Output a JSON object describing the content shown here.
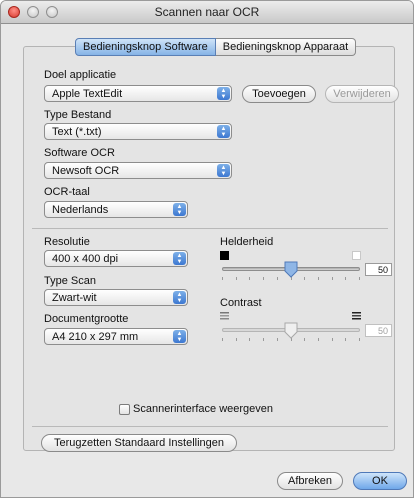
{
  "window": {
    "title": "Scannen naar OCR"
  },
  "tabs": [
    {
      "label": "Bedieningsknop Software",
      "selected": true
    },
    {
      "label": "Bedieningsknop Apparaat",
      "selected": false
    }
  ],
  "target_app": {
    "label": "Doel applicatie",
    "value": "Apple TextEdit",
    "add_button": "Toevoegen",
    "remove_button": "Verwijderen"
  },
  "file_type": {
    "label": "Type Bestand",
    "value": "Text (*.txt)"
  },
  "ocr_software": {
    "label": "Software OCR",
    "value": "Newsoft OCR"
  },
  "ocr_language": {
    "label": "OCR-taal",
    "value": "Nederlands"
  },
  "resolution": {
    "label": "Resolutie",
    "value": "400 x 400 dpi"
  },
  "scan_type": {
    "label": "Type Scan",
    "value": "Zwart-wit"
  },
  "document_size": {
    "label": "Documentgrootte",
    "value": "A4  210 x 297 mm"
  },
  "brightness": {
    "label": "Helderheid",
    "value": "50",
    "level": 0.5,
    "enabled": true
  },
  "contrast": {
    "label": "Contrast",
    "value": "50",
    "level": 0.5,
    "enabled": false
  },
  "scanner_interface": {
    "label": "Scannerinterface weergeven",
    "checked": false
  },
  "reset_button": "Terugzetten Standaard Instellingen",
  "cancel_button": "Afbreken",
  "ok_button": "OK",
  "colors": {
    "accent": "#3d78d1",
    "close": "#d83a2f"
  },
  "icons": {
    "popup_arrows": "up-down-arrows-icon",
    "brightness_low": "black-square-icon",
    "brightness_high": "white-square-icon",
    "contrast_low": "lines-low-contrast-icon",
    "contrast_high": "lines-high-contrast-icon"
  }
}
